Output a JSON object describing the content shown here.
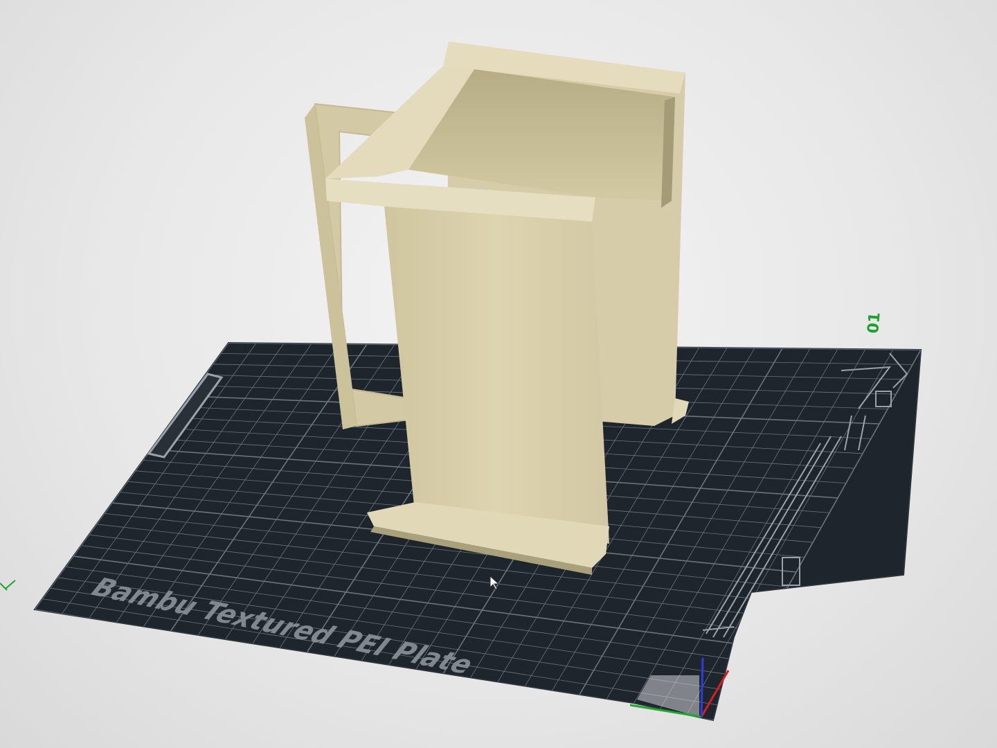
{
  "viewport": {
    "plate_label": "Bambu Textured PEI Plate",
    "plate_number": "01",
    "colors": {
      "background": "#ececec",
      "plate": "#1f252c",
      "grid": "#6b7480",
      "model": "#d8cfa8",
      "model_shadow": "#b8ae86",
      "axis_x": "#d62020",
      "axis_y": "#1fa82a",
      "axis_z": "#2b3de0",
      "plate_number_color": "#20a030"
    },
    "model_name": "mug-shaped object",
    "cursor_icon": "pointer-cursor-icon"
  }
}
